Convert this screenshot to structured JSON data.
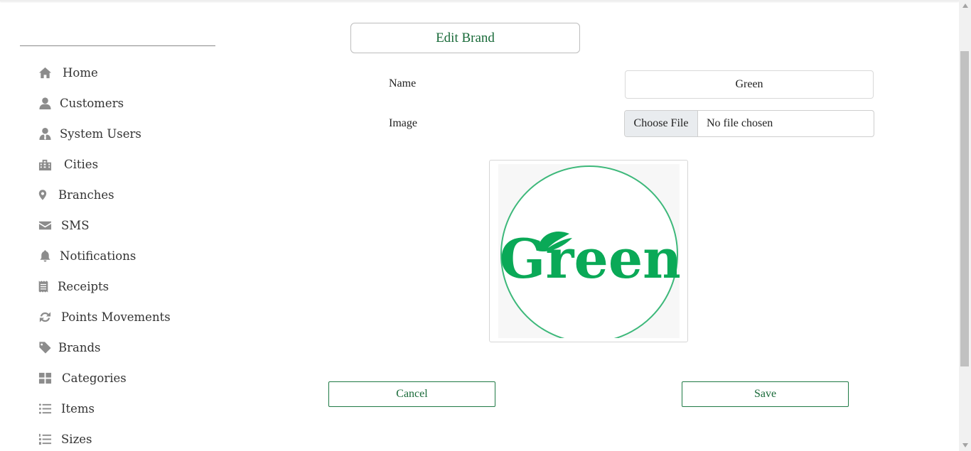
{
  "sidebar": {
    "items": [
      {
        "label": "Home",
        "icon": "home-icon"
      },
      {
        "label": "Customers",
        "icon": "user-icon"
      },
      {
        "label": "System Users",
        "icon": "user-tie-icon"
      },
      {
        "label": "Cities",
        "icon": "building-icon"
      },
      {
        "label": "Branches",
        "icon": "map-marker-icon"
      },
      {
        "label": "SMS",
        "icon": "envelope-icon"
      },
      {
        "label": "Notifications",
        "icon": "bell-icon"
      },
      {
        "label": "Receipts",
        "icon": "receipt-icon"
      },
      {
        "label": "Points Movements",
        "icon": "refresh-icon"
      },
      {
        "label": "Brands",
        "icon": "tag-icon"
      },
      {
        "label": "Categories",
        "icon": "grid-icon"
      },
      {
        "label": "Items",
        "icon": "list-icon"
      },
      {
        "label": "Sizes",
        "icon": "list-ol-icon"
      }
    ]
  },
  "form": {
    "title": "Edit Brand",
    "name_label": "Name",
    "name_value": "Green",
    "image_label": "Image",
    "choose_file_label": "Choose File",
    "file_status": "No file chosen",
    "logo_text": "Green",
    "cancel_label": "Cancel",
    "save_label": "Save"
  },
  "colors": {
    "accent": "#1a6b3a",
    "logo_green": "#0aa957",
    "icon_gray": "#8c8c8c"
  }
}
